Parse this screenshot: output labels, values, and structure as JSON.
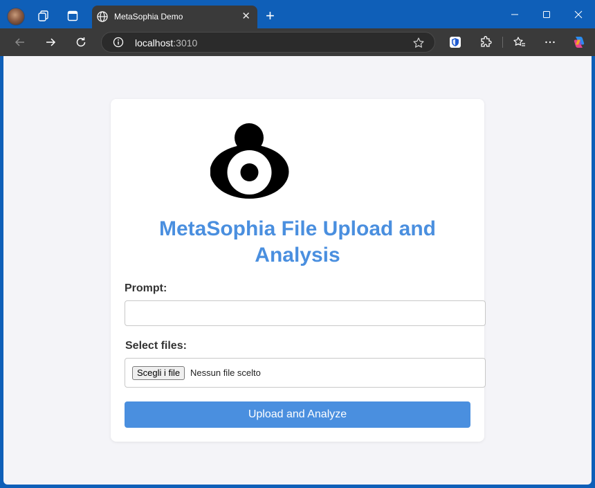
{
  "browser": {
    "tab_title": "MetaSophia Demo",
    "url_host": "localhost",
    "url_port": ":3010",
    "icons": [
      "profile-avatar",
      "workspaces-icon",
      "tab-actions-icon",
      "globe-icon",
      "close-icon",
      "new-tab-icon",
      "minimize-icon",
      "maximize-icon",
      "window-close-icon",
      "back-icon",
      "forward-icon",
      "refresh-icon",
      "info-icon",
      "favorite-star-icon",
      "extension-shield-icon",
      "extensions-icon",
      "favorites-icon",
      "more-icon",
      "copilot-icon"
    ]
  },
  "page": {
    "heading": "MetaSophia File Upload and Analysis",
    "prompt_label": "Prompt:",
    "prompt_value": "",
    "files_label": "Select files:",
    "file_button": "Scegli i file",
    "file_status": "Nessun file scelto",
    "submit_label": "Upload and Analyze"
  },
  "colors": {
    "accent": "#4a8fdf",
    "titlebar": "#0f5fb8",
    "toolbar": "#3a3a3a",
    "background": "#f4f4f8"
  }
}
